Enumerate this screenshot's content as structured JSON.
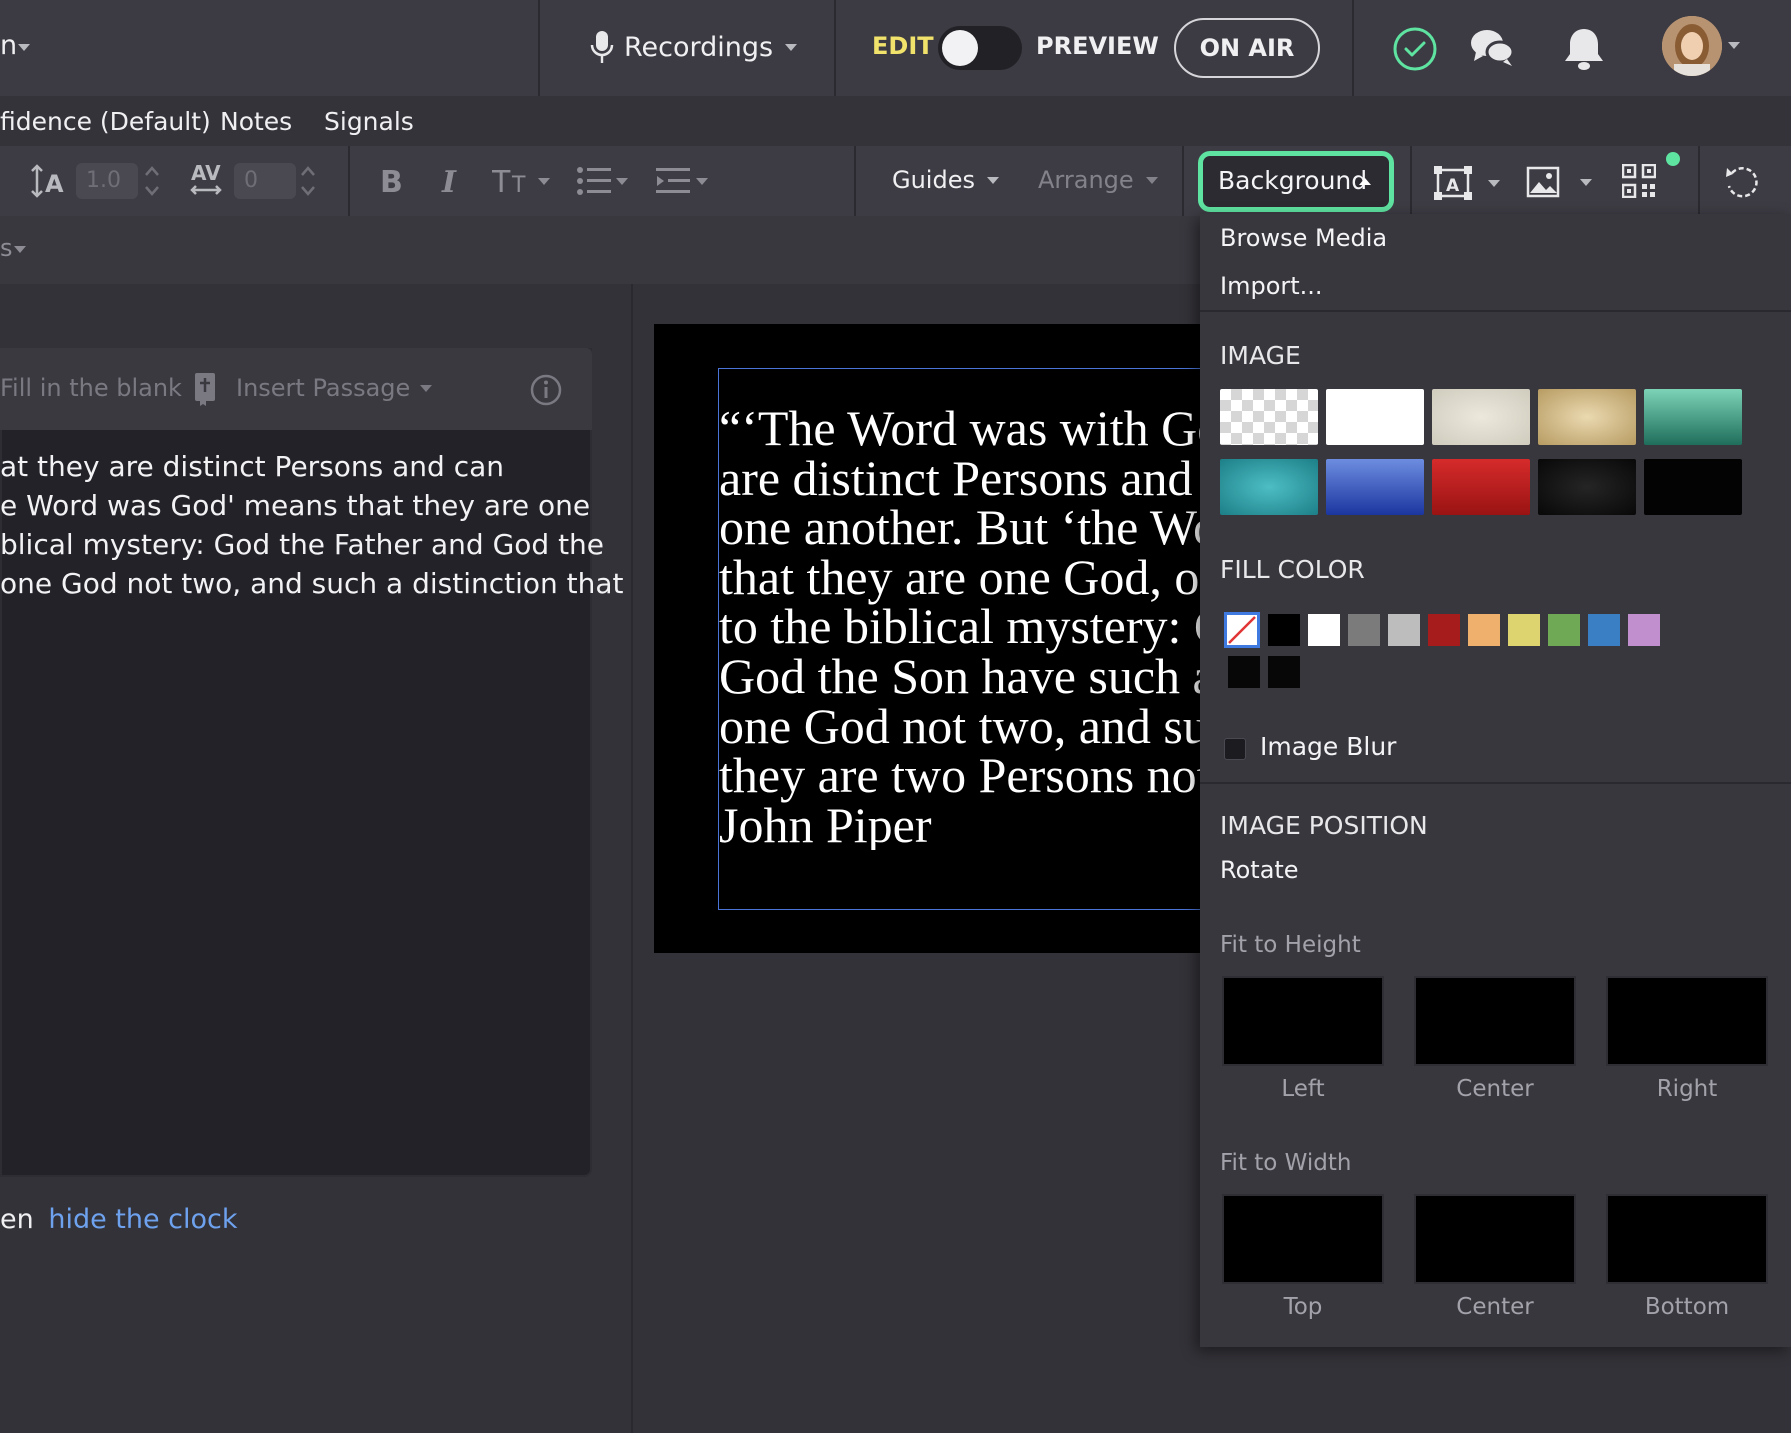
{
  "topbar": {
    "left_fragment": "n",
    "recordings_label": "Recordings",
    "edit_label": "EDIT",
    "preview_label": "PREVIEW",
    "on_air_label": "ON AIR"
  },
  "tabs": [
    "fidence (Default)",
    "Notes",
    "Signals"
  ],
  "toolbar": {
    "line_height_value": "1.0",
    "letter_spacing_value": "0",
    "guides_label": "Guides",
    "arrange_label": "Arrange",
    "background_label": "Background"
  },
  "subbar": {
    "fragment": "s"
  },
  "editor": {
    "fill_blank_label": "Fill in the blank",
    "insert_passage_label": "Insert Passage",
    "lines": [
      "at they are distinct Persons and can",
      "e Word was God' means that they are one",
      "blical mystery: God the Father and God the",
      "one God not two, and such a distinction that"
    ],
    "footer_prefix": "en",
    "footer_link": "hide the clock"
  },
  "slide": {
    "lines": [
      "“‘The Word was with God’ means that they",
      "are distinct Persons and can have fellowship with",
      "one another. But ‘the Word was God’ means",
      "that they are one God, one divine essence. Welcome",
      "to the biblical mystery: God the Father and",
      "God the Son have such a unity that they are",
      "one God not two, and such a distinction that",
      "they are two Persons not one.”",
      "John Piper"
    ]
  },
  "background_menu": {
    "browse_media": "Browse Media",
    "import": "Import...",
    "image_heading": "IMAGE",
    "fill_color_heading": "FILL COLOR",
    "image_blur_label": "Image Blur",
    "image_position_heading": "IMAGE POSITION",
    "rotate_label": "Rotate",
    "fit_to_height_label": "Fit to Height",
    "fit_to_width_label": "Fit to Width",
    "height_positions": [
      "Left",
      "Center",
      "Right"
    ],
    "width_positions": [
      "Top",
      "Center",
      "Bottom"
    ],
    "fill_colors": [
      "#000000",
      "#ffffff",
      "#7b7b7b",
      "#bdbdbd",
      "#a61b1b",
      "#efb06d",
      "#ddd36f",
      "#6fa955",
      "#3a7fc4",
      "#c18fcd",
      "#070707",
      "#070707"
    ]
  },
  "colors": {
    "accent_green": "#5fe3a1",
    "edit_yellow": "#f1e26b",
    "link_blue": "#6ea2ef",
    "selection_blue": "#4a74d8"
  }
}
